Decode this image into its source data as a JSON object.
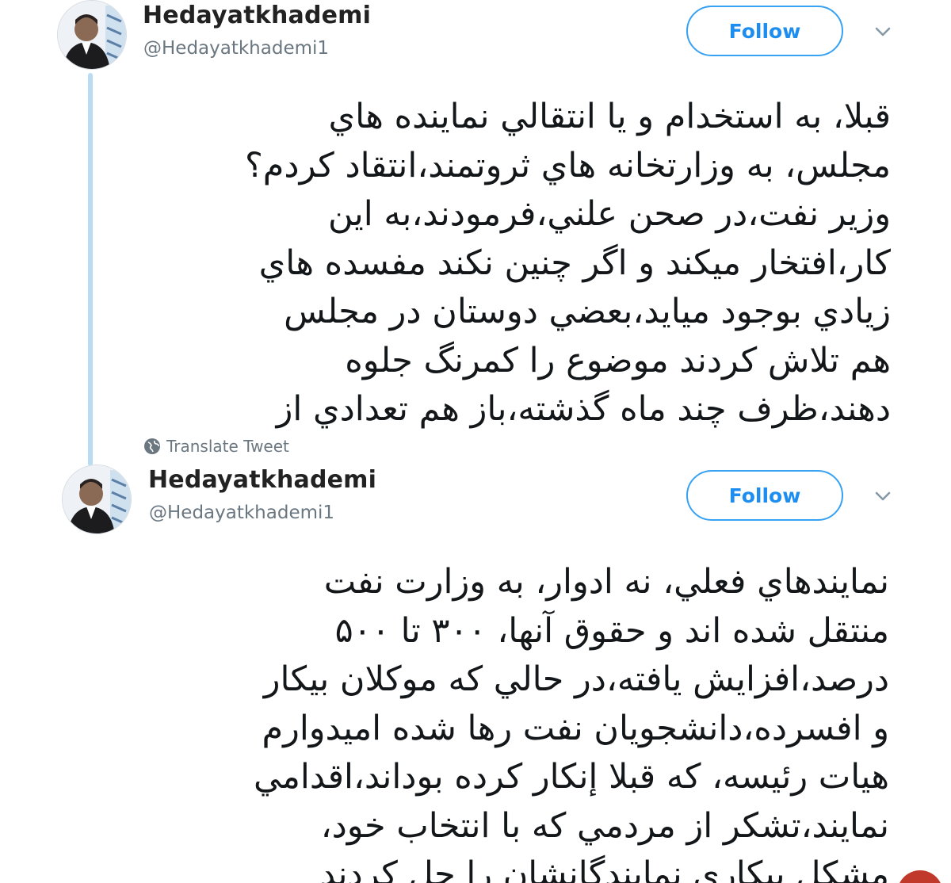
{
  "tweets": [
    {
      "display_name": "Hedayatkhademi",
      "handle": "@Hedayatkhademi1",
      "follow_label": "Follow",
      "text_lines": [
        "قبلا، به استخدام و يا انتقالي نماينده هاي",
        "مجلس، به وزارتخانه هاي ثروتمند،انتقاد كردم؟",
        "وزير نفت،در صحن علني،فرمودند،به اين",
        "كار،افتخار ميكند و اگر چنين نكند مفسده هاي",
        "زيادي بوجود ميايد،بعضي دوستان در مجلس",
        "هم تلاش كردند موضوع را كمرنگ جلوه",
        "دهند،ظرف چند ماه گذشته،باز هم تعدادي از"
      ],
      "translate_label": "Translate Tweet"
    },
    {
      "display_name": "Hedayatkhademi",
      "handle": "@Hedayatkhademi1",
      "follow_label": "Follow",
      "text_lines": [
        "نمايندهاي فعلي، نه ادوار، به وزارت نفت",
        "منتقل شده اند و حقوق آنها، ۳۰۰ تا ۵۰۰",
        "درصد،افزايش يافته،در حالي كه موكلان بيكار",
        "و افسرده،دانشجويان نفت رها شده اميدوارم",
        "هيات رئيسه، كه قبلا إنكار كرده بوداند،اقدامي",
        "نمايند،تشكر از مردمي كه با انتخاب خود،",
        "مشكل بيكاري نمايندگانشان را حل كردند"
      ]
    }
  ],
  "icons": {
    "menu": "chevron-down-icon",
    "translate": "globe-icon"
  },
  "colors": {
    "accent": "#1d8ef0",
    "thread_line": "#b9dcf2",
    "secondary_text": "#6b7780"
  }
}
